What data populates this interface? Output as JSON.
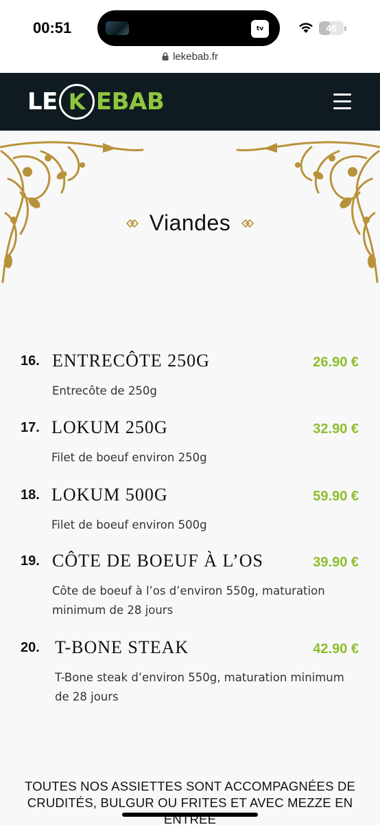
{
  "status_bar": {
    "time": "00:51",
    "battery": "46",
    "battery_level": 0.46,
    "island_app": "tv"
  },
  "browser": {
    "url": "lekebab.fr"
  },
  "header": {
    "logo_le": "LE",
    "logo_k": "K",
    "logo_ebab": "EBAB"
  },
  "section": {
    "title": "Viandes"
  },
  "items": [
    {
      "num": "16.",
      "name": "ENTRECÔTE 250G",
      "price": "26.90 €",
      "desc": [
        "Entrecôte de 250g"
      ]
    },
    {
      "num": "17.",
      "name": "LOKUM 250G",
      "price": "32.90 €",
      "desc": [
        "Filet de boeuf environ 250g"
      ]
    },
    {
      "num": "18.",
      "name": "LOKUM 500G",
      "price": "59.90 €",
      "desc": [
        "Filet de boeuf environ 500g"
      ]
    },
    {
      "num": "19.",
      "name": "CÔTE DE BOEUF À L’OS",
      "price": "39.90 €",
      "desc": [
        "Côte de boeuf à l’os d’environ 550g, maturation",
        "minimum de 28 jours"
      ]
    },
    {
      "num": "20.",
      "name": "T-BONE STEAK",
      "price": "42.90 €",
      "desc": [
        "T-Bone steak d’environ 550g, maturation minimum",
        "de 28 jours"
      ]
    }
  ],
  "footer": {
    "line1": "TOUTES NOS ASSIETTES SONT ACCOMPAGNÉES DE",
    "line2": "CRUDITÉS, BULGUR OU FRITES ET AVEC MEZZE EN",
    "line3": "ENTRÉE"
  },
  "colors": {
    "header_bg": "#0f1b20",
    "accent_green": "#8ebd2c",
    "ornament_gold": "#b8923a"
  }
}
